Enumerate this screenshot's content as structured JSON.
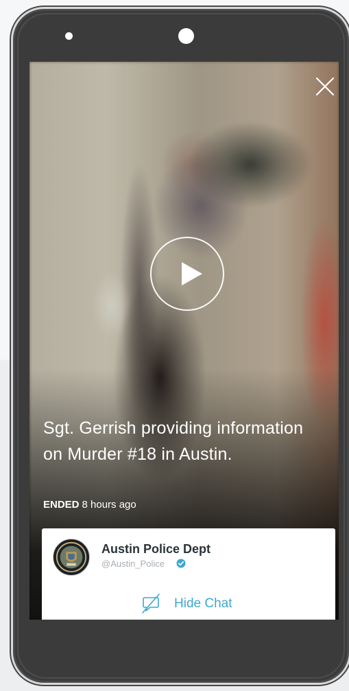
{
  "broadcast": {
    "title": "Sgt. Gerrish providing information on Murder #18 in Austin.",
    "status": "ENDED",
    "time_ago": "8 hours ago"
  },
  "user": {
    "name": "Austin Police Dept",
    "handle": "@Austin_Police",
    "verified": true
  },
  "chat": {
    "hide_label": "Hide Chat"
  },
  "icons": {
    "close": "close-icon",
    "play": "play-icon",
    "verified": "verified-badge-icon",
    "hide_chat": "chat-hidden-icon"
  },
  "colors": {
    "accent": "#3ea7cf",
    "phone_body": "#3b3b3b",
    "card_background": "#ffffff",
    "name_text": "#2a3338",
    "handle_text": "#a8aeb2"
  }
}
